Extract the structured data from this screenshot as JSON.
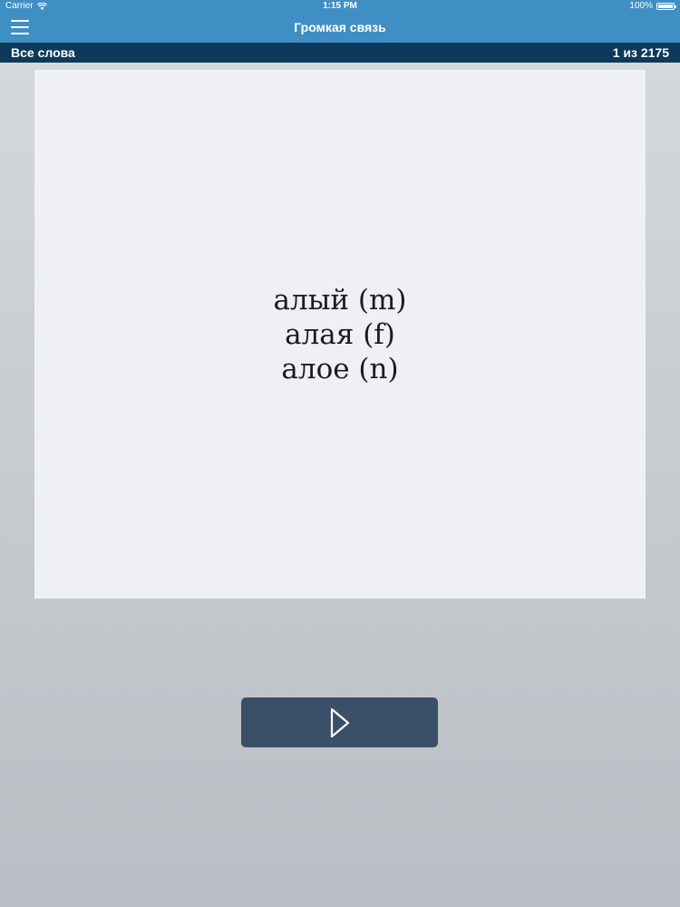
{
  "statusbar": {
    "carrier": "Carrier",
    "time": "1:15 PM",
    "battery": "100%"
  },
  "navbar": {
    "title": "Громкая связь",
    "menu_icon": "hamburger-menu-icon"
  },
  "subheader": {
    "list_name": "Все слова",
    "counter": "1 из 2175"
  },
  "card": {
    "lines": [
      "алый (m)",
      "алая (f)",
      "алое (n)"
    ]
  },
  "controls": {
    "play_icon": "play-outline-icon"
  },
  "colors": {
    "navbar": "#3f8fc5",
    "subheader": "#0d3a5a",
    "card": "#eef0f3",
    "button": "#3a5068"
  }
}
